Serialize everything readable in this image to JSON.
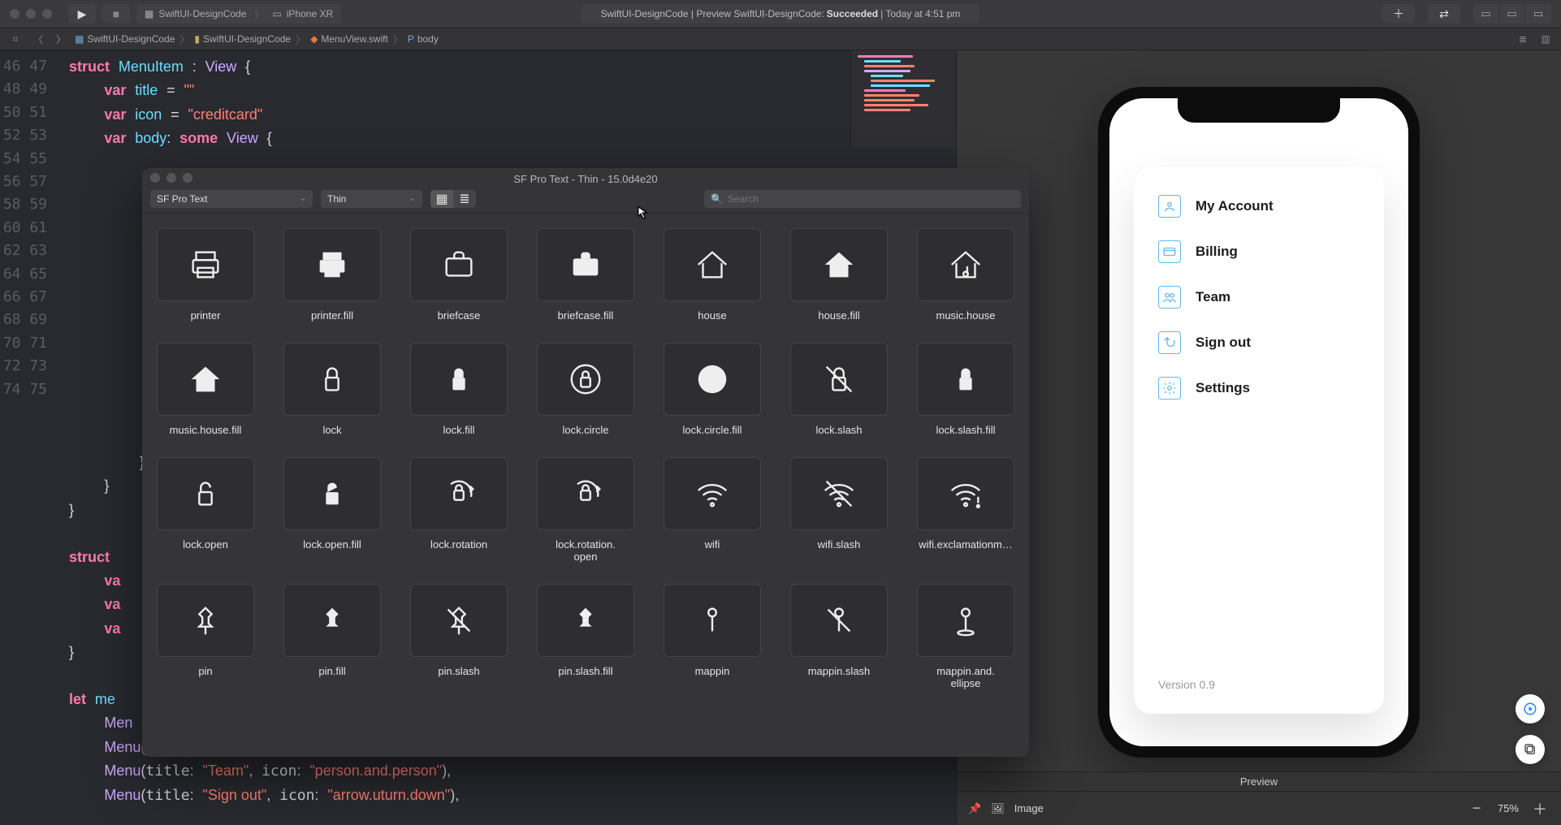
{
  "titlebar": {
    "scheme_project": "SwiftUI-DesignCode",
    "scheme_device": "iPhone XR",
    "status_prefix": "SwiftUI-DesignCode | Preview SwiftUI-DesignCode:",
    "status_state": "Succeeded",
    "status_time": "| Today at 4:51 pm"
  },
  "jumpbar": {
    "crumbs": [
      "SwiftUI-DesignCode",
      "SwiftUI-DesignCode",
      "MenuView.swift",
      "body"
    ]
  },
  "code": {
    "lines": [
      46,
      47,
      48,
      49,
      50,
      51,
      52,
      53,
      54,
      55,
      56,
      57,
      58,
      59,
      60,
      61,
      62,
      63,
      64,
      65,
      66,
      67,
      68,
      69,
      70,
      71,
      72,
      73,
      74,
      75
    ]
  },
  "sf": {
    "title": "SF Pro Text - Thin - 15.0d4e20",
    "font": "SF Pro Text",
    "weight": "Thin",
    "search_placeholder": "Search",
    "icons": [
      "printer",
      "printer.fill",
      "briefcase",
      "briefcase.fill",
      "house",
      "house.fill",
      "music.house",
      "music.house.fill",
      "lock",
      "lock.fill",
      "lock.circle",
      "lock.circle.fill",
      "lock.slash",
      "lock.slash.fill",
      "lock.open",
      "lock.open.fill",
      "lock.rotation",
      "lock.rotation.open",
      "wifi",
      "wifi.slash",
      "wifi.exclamationm…",
      "pin",
      "pin.fill",
      "pin.slash",
      "pin.slash.fill",
      "mappin",
      "mappin.slash",
      "mappin.and.ellipse"
    ],
    "rotation_open_label": "lock.rotation.open"
  },
  "menu": {
    "items": [
      {
        "label": "My Account"
      },
      {
        "label": "Billing"
      },
      {
        "label": "Team"
      },
      {
        "label": "Sign out"
      },
      {
        "label": "Settings"
      }
    ],
    "version": "Version 0.9"
  },
  "preview": {
    "tab": "Preview",
    "image_label": "Image",
    "zoom": "75%"
  }
}
